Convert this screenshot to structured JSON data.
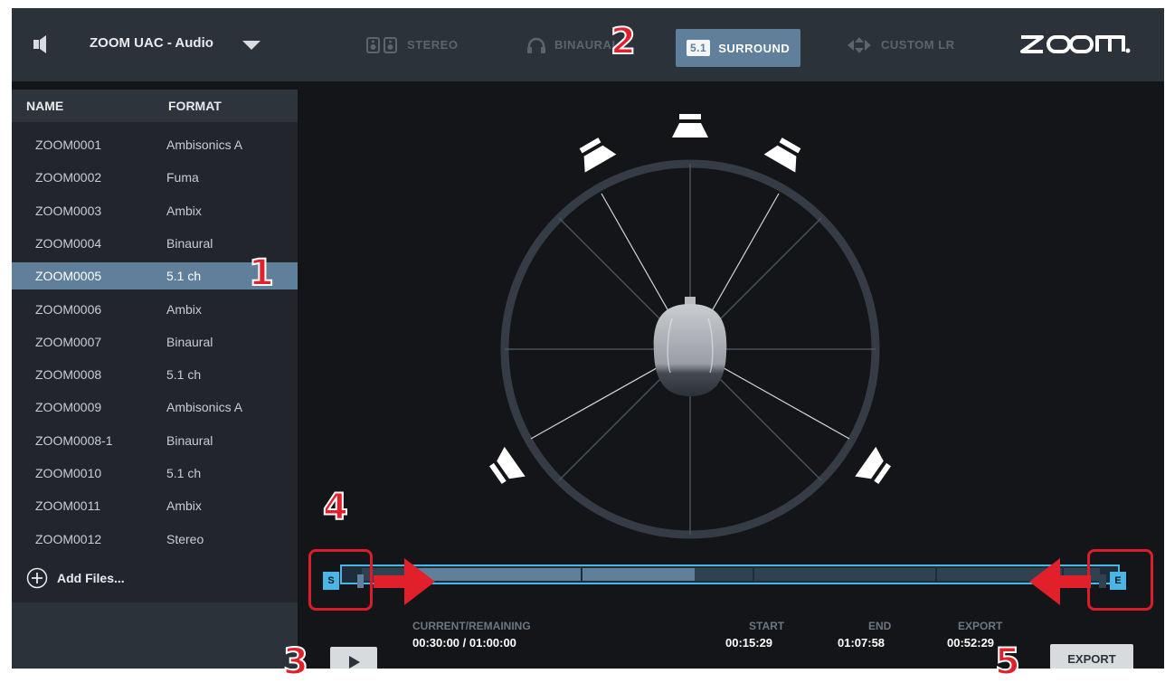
{
  "header": {
    "device_name": "ZOOM UAC - Audio",
    "modes": [
      {
        "label": "STEREO",
        "icon": "speakers-icon",
        "active": false
      },
      {
        "label": "BINAURAL",
        "icon": "headphones-icon",
        "active": false
      },
      {
        "label": "SURROUND",
        "badge": "5.1",
        "icon": "surround-icon",
        "active": true
      },
      {
        "label": "CUSTOM LR",
        "icon": "custom-lr-icon",
        "active": false
      }
    ],
    "logo_text": "ZOOM"
  },
  "file_list": {
    "col_name": "NAME",
    "col_format": "FORMAT",
    "files": [
      {
        "name": "ZOOM0001",
        "format": "Ambisonics A"
      },
      {
        "name": "ZOOM0002",
        "format": "Fuma"
      },
      {
        "name": "ZOOM0003",
        "format": "Ambix"
      },
      {
        "name": "ZOOM0004",
        "format": "Binaural"
      },
      {
        "name": "ZOOM0005",
        "format": "5.1 ch"
      },
      {
        "name": "ZOOM0006",
        "format": "Ambix"
      },
      {
        "name": "ZOOM0007",
        "format": "Binaural"
      },
      {
        "name": "ZOOM0008",
        "format": "5.1 ch"
      },
      {
        "name": "ZOOM0009",
        "format": "Ambisonics A"
      },
      {
        "name": "ZOOM0008-1",
        "format": "Binaural"
      },
      {
        "name": "ZOOM0010",
        "format": "5.1 ch"
      },
      {
        "name": "ZOOM0011",
        "format": "Ambix"
      },
      {
        "name": "ZOOM0012",
        "format": "Stereo"
      }
    ],
    "selected_index": 4,
    "add_files_label": "Add Files..."
  },
  "timeline": {
    "start_marker": "S",
    "end_marker": "E"
  },
  "transport": {
    "current_remaining_label": "CURRENT/REMAINING",
    "current_remaining_value": "00:30:00 / 01:00:00",
    "start_label": "START",
    "start_value": "00:15:29",
    "end_label": "END",
    "end_value": "01:07:58",
    "export_label": "EXPORT",
    "export_value": "00:52:29",
    "export_button": "EXPORT"
  },
  "callouts": [
    "1",
    "2",
    "3",
    "4",
    "5"
  ],
  "colors": {
    "accent": "#5f7f9a",
    "timeline": "#4bb6e6",
    "callout": "#e1202b"
  }
}
